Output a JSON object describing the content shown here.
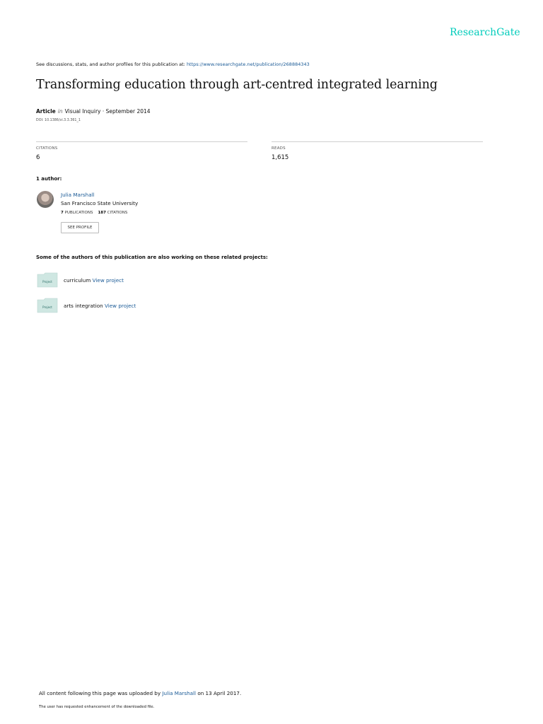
{
  "brand": "ResearchGate",
  "top_note": {
    "text": "See discussions, stats, and author profiles for this publication at: ",
    "url": "https://www.researchgate.net/publication/268884343"
  },
  "title": "Transforming education through art-centred integrated learning",
  "article": {
    "type": "Article",
    "in": "in",
    "source": "Visual Inquiry · September 2014",
    "doi": "DOI: 10.1386/vi.3.3.361_1"
  },
  "stats": {
    "citations_label": "CITATIONS",
    "citations_value": "6",
    "reads_label": "READS",
    "reads_value": "1,615"
  },
  "authors_label": "1 author:",
  "author": {
    "name": "Julia Marshall",
    "affiliation": "San Francisco State University",
    "publications_count": "7",
    "publications_label": "PUBLICATIONS",
    "citations_count": "187",
    "citations_label": "CITATIONS",
    "profile_button": "SEE PROFILE"
  },
  "related_label": "Some of the authors of this publication are also working on these related projects:",
  "projects": [
    {
      "icon_label": "Project",
      "name": "curriculum",
      "link": "View project"
    },
    {
      "icon_label": "Project",
      "name": "arts integration",
      "link": "View project"
    }
  ],
  "footer": {
    "prefix": "All content following this page was uploaded by ",
    "uploader": "Julia Marshall",
    "suffix": " on 13 April 2017.",
    "note": "The user has requested enhancement of the downloaded file."
  },
  "colors": {
    "brand": "#00ccbb",
    "link": "#1a5a96",
    "project_icon": "#cfe7e2"
  }
}
